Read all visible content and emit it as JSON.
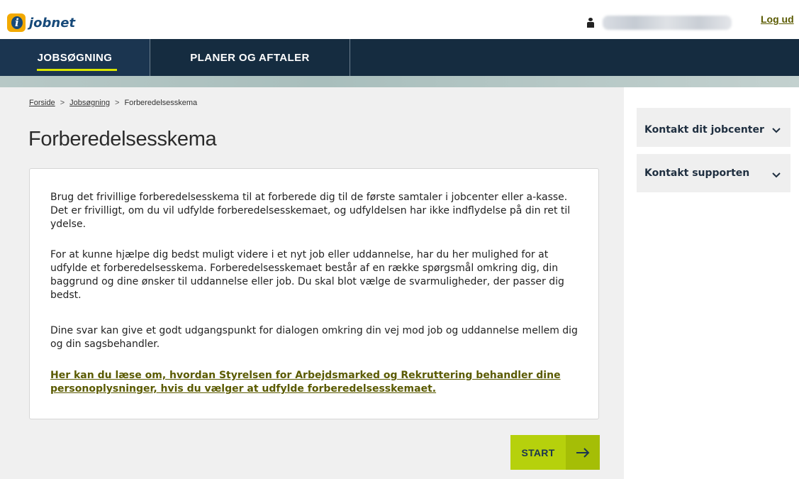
{
  "header": {
    "logo_text": "jobnet",
    "logo_letter": "i",
    "logout_label": "Log ud"
  },
  "nav": {
    "tabs": [
      {
        "label": "JOBSØGNING",
        "active": true
      },
      {
        "label": "PLANER OG AFTALER",
        "active": false
      }
    ]
  },
  "breadcrumb": {
    "items": [
      "Forside",
      "Jobsøgning",
      "Forberedelsesskema"
    ],
    "separator": ">"
  },
  "page": {
    "title": "Forberedelsesskema",
    "paragraphs": [
      "Brug det frivillige forberedelsesskema til at forberede dig til de første samtaler i jobcenter eller a-kasse. Det er frivilligt, om du vil udfylde forberedelsesskemaet, og udfyldelsen har ikke indflydelse på din ret til ydelse.",
      "For at kunne hjælpe dig bedst muligt videre i et nyt job eller uddannelse, har du her mulighed for at udfylde et forberedelsesskema. Forberedelsesskemaet består af en række spørgsmål omkring dig, din baggrund og dine ønsker til uddannelse eller job. Du skal blot vælge de svarmuligheder, der passer dig bedst.",
      "Dine svar kan give et godt udgangspunkt for dialogen omkring din vej mod job og uddannelse mellem dig og din sagsbehandler."
    ],
    "privacy_link": "Her kan du læse om, hvordan Styrelsen for Arbejdsmarked og Rekruttering behandler dine personoplysninger, hvis du vælger at udfylde forberedelsesskemaet.",
    "start_label": "START"
  },
  "sidebar": {
    "items": [
      {
        "label": "Kontakt dit jobcenter"
      },
      {
        "label": "Kontakt supporten"
      }
    ]
  },
  "colors": {
    "nav_bg": "#152c40",
    "accent_green": "#b6d10c",
    "link_olive": "#5a5a00",
    "logo_orange": "#f2a900",
    "logo_blue": "#174a7a"
  },
  "icons": {
    "user": "user-icon",
    "chevron": "chevron-down-icon",
    "arrow": "arrow-right-icon"
  }
}
